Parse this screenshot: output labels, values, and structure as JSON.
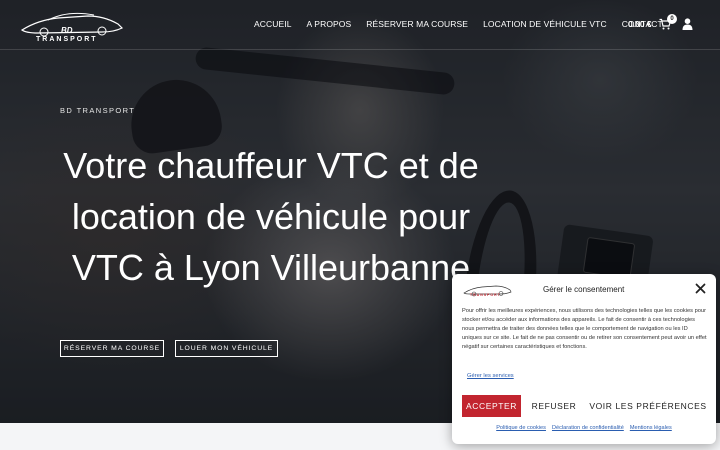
{
  "brand": {
    "logo_text": "TRANSPORT",
    "logo_initials": "BD"
  },
  "nav": {
    "items": [
      {
        "label": "ACCUEIL"
      },
      {
        "label": "A PROPOS"
      },
      {
        "label": "RÉSERVER MA COURSE"
      },
      {
        "label": "LOCATION DE VÉHICULE VTC"
      },
      {
        "label": "CONTACT"
      }
    ],
    "cart_total": "0.00 €",
    "cart_count": "0"
  },
  "hero": {
    "kicker": "BD TRANSPORT",
    "headline": "Votre chauffeur VTC et de location de véhicule pour VTC à Lyon Villeurbanne",
    "button_reserve": "RÉSERVER MA COURSE",
    "button_rent": "LOUER MON VÉHICULE"
  },
  "consent": {
    "logo_text": "TRANSPORT",
    "title": "Gérer le consentement",
    "body": "Pour offrir les meilleures expériences, nous utilisons des technologies telles que les cookies pour stocker et/ou accéder aux informations des appareils. Le fait de consentir à ces technologies nous permettra de traiter des données telles que le comportement de navigation ou les ID uniques sur ce site. Le fait de ne pas consentir ou de retirer son consentement peut avoir un effet négatif sur certaines caractéristiques et fonctions.",
    "services_link": "Gérer les services",
    "accept": "ACCEPTER",
    "refuse": "REFUSER",
    "preferences": "VOIR LES PRÉFÉRENCES",
    "footer_links": [
      {
        "label": "Politique de cookies"
      },
      {
        "label": "Déclaration de confidentialité"
      },
      {
        "label": "Mentions légales"
      }
    ]
  },
  "colors": {
    "accent": "#c2252f",
    "link": "#2a5db0"
  }
}
